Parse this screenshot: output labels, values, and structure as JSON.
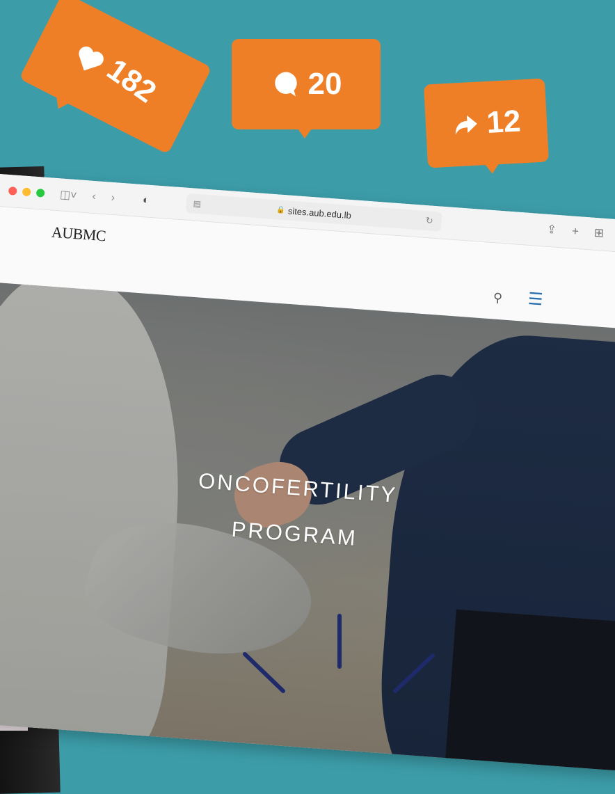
{
  "social": {
    "likes": "182",
    "comments": "20",
    "shares": "12"
  },
  "browser": {
    "url": "sites.aub.edu.lb"
  },
  "site": {
    "logo_name": "AUBMC",
    "hero_title_line1": "ONCOFERTILITY",
    "hero_title_line2": "PROGRAM"
  },
  "icons": [
    "heart-icon",
    "comment-icon",
    "share-arrow-icon",
    "sidebar-icon",
    "back-icon",
    "forward-icon",
    "shield-icon",
    "reader-icon",
    "lock-icon",
    "reload-icon",
    "share-icon",
    "new-tab-icon",
    "tab-overview-icon",
    "search-icon",
    "hamburger-menu-icon"
  ],
  "colors": {
    "background": "#3c9da9",
    "bubble": "#ef7f27",
    "menu_accent": "#2a6fb0",
    "rays": "#1f2a6b"
  }
}
